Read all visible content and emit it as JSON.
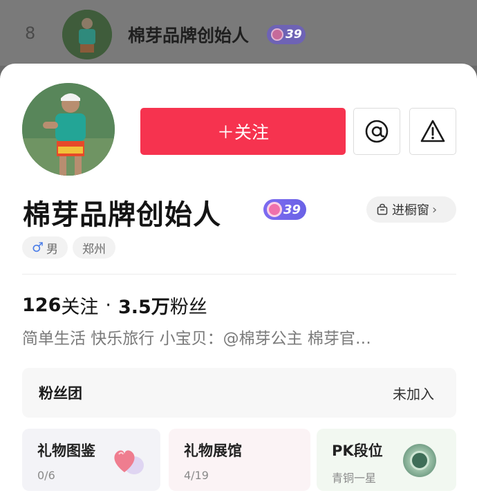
{
  "background_row": {
    "rank": "8",
    "name": "棉芽品牌创始人",
    "level": "39"
  },
  "profile": {
    "follow_label": "＋关注",
    "name": "棉芽品牌创始人",
    "level": "39",
    "shop_label": "进橱窗",
    "shop_chevron": "›",
    "gender_symbol": "♂",
    "gender": "男",
    "city": "郑州",
    "following_count": "126",
    "following_label": "关注",
    "separator": "·",
    "followers_count": "3.5万",
    "followers_label": "粉丝",
    "bio": "简单生活 快乐旅行 小宝贝：@棉芽公主  棉芽官…"
  },
  "fanclub": {
    "title": "粉丝团",
    "status": "未加入"
  },
  "cards": [
    {
      "title": "礼物图鉴",
      "sub": "0/6",
      "icon": "heart-balloon-icon"
    },
    {
      "title": "礼物展馆",
      "sub": "4/19",
      "icon": ""
    },
    {
      "title": "PK段位",
      "sub": "青铜一星",
      "icon": "pk-medal-icon"
    }
  ],
  "colors": {
    "follow_button": "#f6334f",
    "level_badge": "#7d6bf0",
    "gender_icon": "#4a7de8"
  }
}
